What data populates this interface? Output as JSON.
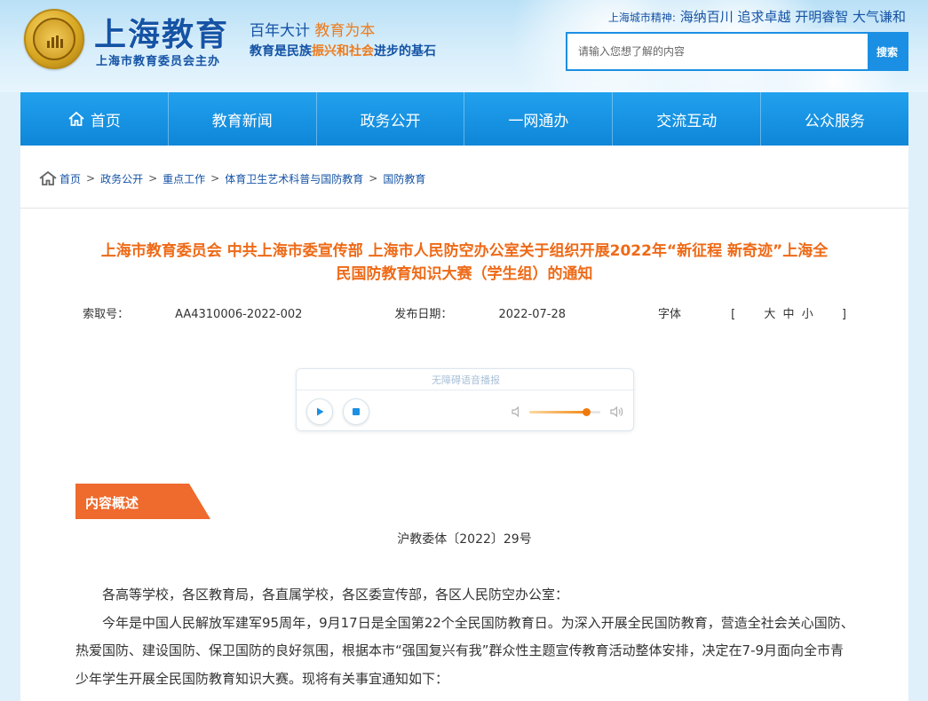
{
  "header": {
    "site_name": "上海教育",
    "site_sub": "上海市教育委员会主办",
    "slogan1_a": "百年大计",
    "slogan1_b": "教育为本",
    "slogan2_a": "教育是民族",
    "slogan2_b": "振兴和社会",
    "slogan2_c": "进步的基石",
    "spirit_label": "上海城市精神:",
    "spirit_text": "海纳百川 追求卓越 开明睿智 大气谦和",
    "search_placeholder": "请输入您想了解的内容",
    "search_button": "搜索"
  },
  "nav": {
    "items": [
      {
        "label": "首页"
      },
      {
        "label": "教育新闻"
      },
      {
        "label": "政务公开"
      },
      {
        "label": "一网通办"
      },
      {
        "label": "交流互动"
      },
      {
        "label": "公众服务"
      }
    ]
  },
  "breadcrumb": {
    "items": [
      "首页",
      "政务公开",
      "重点工作",
      "体育卫生艺术科普与国防教育",
      "国防教育"
    ],
    "separator": ">"
  },
  "article": {
    "title_line1": "上海市教育委员会 中共上海市委宣传部 上海市人民防空办公室关于组织开展2022年“新征程 新奇迹”上海全",
    "title_line2": "民国防教育知识大赛（学生组）的通知",
    "index_label": "索取号：",
    "index_value": "AA4310006-2022-002",
    "date_label": "发布日期：",
    "date_value": "2022-07-28",
    "font_label": "字体",
    "font_open": "[",
    "font_large": "大",
    "font_medium": "中",
    "font_small": "小",
    "font_close": "]"
  },
  "player": {
    "title": "无障碍语音播报",
    "progress": 0,
    "volume": 0.8
  },
  "summary": {
    "tag": "内容概述",
    "doc_number": "沪教委体〔2022〕29号",
    "paragraphs": [
      "各高等学校，各区教育局，各直属学校，各区委宣传部，各区人民防空办公室：",
      "今年是中国人民解放军建军95周年，9月17日是全国第22个全民国防教育日。为深入开展全民国防教育，营造全社会关心国防、热爱国防、建设国防、保卫国防的良好氛围，根据本市“强国复兴有我”群众性主题宣传教育活动整体安排，决定在7-9月面向全市青少年学生开展全民国防教育知识大赛。现将有关事宜通知如下："
    ]
  },
  "colors": {
    "brand_blue": "#1553a5",
    "nav_blue": "#1b8fe3",
    "accent_orange": "#ee6a17"
  }
}
